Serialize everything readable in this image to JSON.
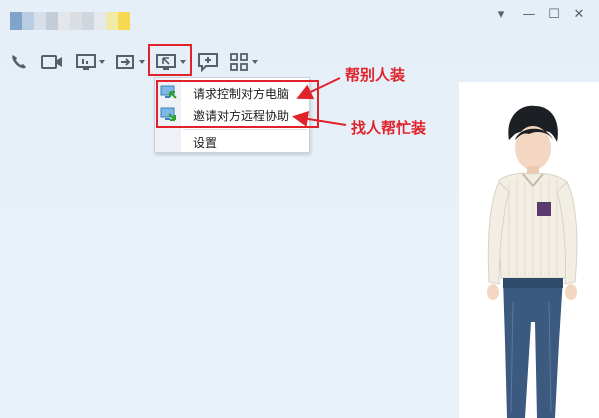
{
  "title_bar": {
    "blur_colors": [
      "#7fa3c9",
      "#b9cde2",
      "#d7dfe8",
      "#c3cdd7",
      "#e3e6ea",
      "#d9dee3",
      "#cfd6dd",
      "#e6e9ec",
      "#f0e9a8",
      "#f6d94f"
    ],
    "minimize_glyph": "—",
    "restore_glyph": "☐",
    "close_glyph": "✕",
    "dropdown_glyph": "▾"
  },
  "toolbar": {
    "items": [
      {
        "name": "phone-icon"
      },
      {
        "name": "video-icon"
      },
      {
        "name": "screen-share-icon"
      },
      {
        "name": "file-transfer-icon"
      },
      {
        "name": "remote-assist-icon"
      },
      {
        "name": "add-comment-icon"
      },
      {
        "name": "apps-grid-icon"
      }
    ]
  },
  "menu": {
    "items": [
      {
        "label": "请求控制对方电脑",
        "icon": "request-control-icon"
      },
      {
        "label": "邀请对方远程协助",
        "icon": "invite-assist-icon"
      },
      {
        "label": "设置",
        "icon": ""
      }
    ]
  },
  "annotations": {
    "help_install": "帮别人装",
    "find_help": "找人帮忙装"
  },
  "colors": {
    "accent_red": "#e0222a",
    "background": "#e8f0f9",
    "icon_gray": "#56606b"
  }
}
